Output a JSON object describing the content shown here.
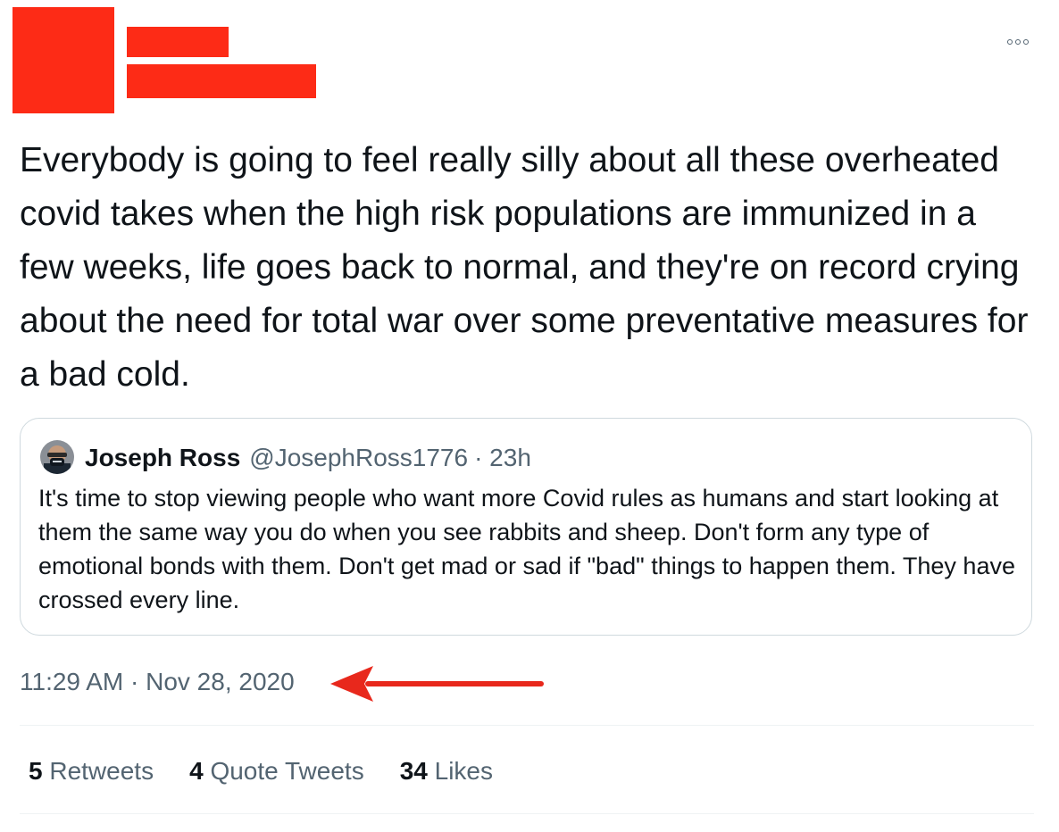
{
  "tweet": {
    "text": "Everybody is going to feel really silly about all these overheated covid takes when the high risk populations are immunized in a few weeks, life goes back to normal, and they're on record crying about the need for total war over some preventative measures for a bad cold.",
    "more_icon": "more-horizontal-icon",
    "timestamp": "11:29 AM · Nov 28, 2020"
  },
  "quoted_tweet": {
    "name": "Joseph Ross",
    "handle": "@JosephRoss1776",
    "time": "· 23h",
    "text": "It's time to stop viewing people who want more Covid rules as humans and start looking at them the same way you do when you see rabbits and sheep. Don't form any type of emotional bonds with them. Don't get mad or sad if \"bad\" things to happen them. They have crossed every line."
  },
  "stats": {
    "retweets_count": "5",
    "retweets_label": "Retweets",
    "quotes_count": "4",
    "quotes_label": "Quote Tweets",
    "likes_count": "34",
    "likes_label": "Likes"
  },
  "colors": {
    "redaction": "#fd2b16",
    "annotation_arrow": "#e8281c",
    "secondary_text": "#536471",
    "border": "#cfd9de"
  }
}
